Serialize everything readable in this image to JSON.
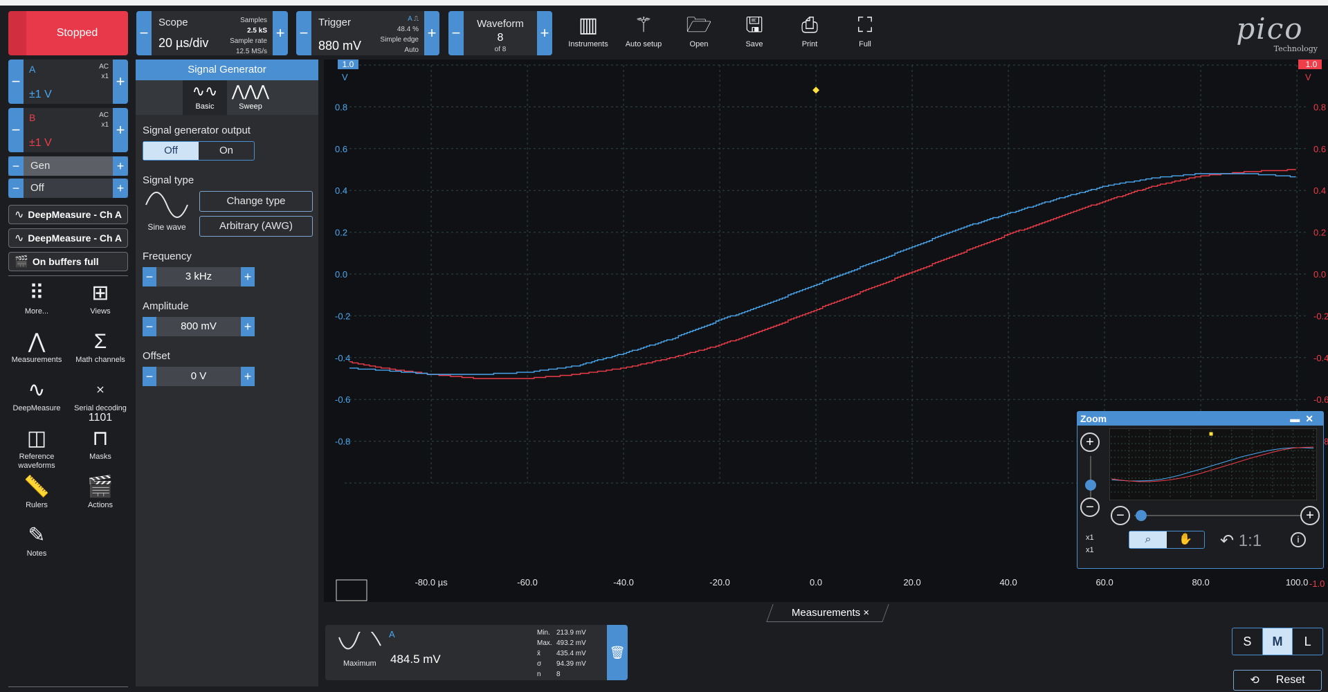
{
  "toolbar": {
    "run_button": "Stopped",
    "scope": {
      "label": "Scope",
      "timebase": "20 µs/div",
      "samples_label": "Samples",
      "samples_value": "2.5 kS",
      "rate_label": "Sample rate",
      "rate_value": "12.5 MS/s"
    },
    "trigger": {
      "label": "Trigger",
      "level": "880 mV",
      "channel": "A",
      "percent": "48.4 %",
      "type": "Simple edge",
      "mode": "Auto"
    },
    "waveform": {
      "label": "Waveform",
      "current": "8",
      "of": "of 8"
    },
    "buttons": [
      {
        "id": "instruments",
        "label": "Instruments",
        "icon": "instruments-icon"
      },
      {
        "id": "auto-setup",
        "label": "Auto setup",
        "icon": "wand-icon"
      },
      {
        "id": "open",
        "label": "Open",
        "icon": "folder-icon"
      },
      {
        "id": "save",
        "label": "Save",
        "icon": "save-icon"
      },
      {
        "id": "print",
        "label": "Print",
        "icon": "print-icon"
      },
      {
        "id": "full",
        "label": "Full",
        "icon": "fullscreen-icon"
      }
    ],
    "logo": {
      "brand": "pico",
      "tagline": "Technology"
    }
  },
  "channels": [
    {
      "name": "A",
      "range": "±1 V",
      "coupling": "AC",
      "probe": "x1",
      "color": "#4aa8f0"
    },
    {
      "name": "B",
      "range": "±1 V",
      "coupling": "AC",
      "probe": "x1",
      "color": "#ef3e4a"
    }
  ],
  "generator_toggle": {
    "label": "Gen",
    "state": "Off"
  },
  "pills": [
    "DeepMeasure - Ch A",
    "DeepMeasure - Ch A",
    "On buffers full"
  ],
  "tools": [
    {
      "label": "More...",
      "icon": "grid-dots-icon"
    },
    {
      "label": "Views",
      "icon": "views-icon"
    },
    {
      "label": "Measurements",
      "icon": "measurements-icon"
    },
    {
      "label": "Math channels",
      "icon": "sigma-icon"
    },
    {
      "label": "DeepMeasure",
      "icon": "deepmeasure-icon"
    },
    {
      "label": "Serial decoding",
      "icon": "serial-decoding-icon"
    },
    {
      "label": "Reference waveforms",
      "icon": "reference-waveforms-icon"
    },
    {
      "label": "Masks",
      "icon": "masks-icon"
    },
    {
      "label": "Rulers",
      "icon": "ruler-icon"
    },
    {
      "label": "Actions",
      "icon": "clapperboard-icon"
    },
    {
      "label": "Notes",
      "icon": "notes-icon"
    }
  ],
  "siggen": {
    "title": "Signal Generator",
    "tabs": [
      "Basic",
      "Sweep"
    ],
    "output_label": "Signal generator output",
    "output_off": "Off",
    "output_on": "On",
    "type_label": "Signal type",
    "wave_name": "Sine wave",
    "change_type": "Change type",
    "arbitrary": "Arbitrary (AWG)",
    "frequency_label": "Frequency",
    "frequency": "3 kHz",
    "amplitude_label": "Amplitude",
    "amplitude": "800 mV",
    "offset_label": "Offset",
    "offset": "0 V"
  },
  "plot": {
    "left_unit": "V",
    "right_unit": "V",
    "top_left_marker": "1.0",
    "top_right_marker": "1.0",
    "y_ticks": [
      "0.8",
      "0.6",
      "0.4",
      "0.2",
      "0.0",
      "-0.2",
      "-0.4",
      "-0.6",
      "-0.8"
    ],
    "y_bottom_right": "-1.0",
    "x_ticks": [
      "-80.0 µs",
      "-60.0",
      "-40.0",
      "-20.0",
      "0.0",
      "20.0",
      "40.0",
      "60.0",
      "80.0",
      "100.0"
    ],
    "x_range_us": [
      -98,
      102
    ],
    "y_range_v": [
      -1.0,
      1.0
    ],
    "trigger_point": {
      "t_us": 0,
      "v": 0.88
    },
    "series_a": {
      "name": "A",
      "color": "#4aa8f0",
      "t_us": [
        -97,
        -90,
        -80,
        -70,
        -60,
        -50,
        -40,
        -30,
        -20,
        -10,
        0,
        10,
        20,
        30,
        40,
        50,
        60,
        70,
        80,
        90,
        100
      ],
      "v": [
        -0.45,
        -0.46,
        -0.48,
        -0.48,
        -0.47,
        -0.44,
        -0.38,
        -0.31,
        -0.22,
        -0.14,
        -0.05,
        0.04,
        0.13,
        0.22,
        0.29,
        0.36,
        0.42,
        0.46,
        0.48,
        0.48,
        0.465
      ]
    },
    "series_b": {
      "name": "B",
      "color": "#ef3e4a",
      "t_us": [
        -97,
        -90,
        -80,
        -70,
        -60,
        -50,
        -40,
        -30,
        -20,
        -10,
        0,
        10,
        20,
        30,
        40,
        50,
        60,
        70,
        80,
        90,
        100
      ],
      "v": [
        -0.42,
        -0.45,
        -0.48,
        -0.5,
        -0.5,
        -0.48,
        -0.45,
        -0.4,
        -0.34,
        -0.26,
        -0.17,
        -0.08,
        0.01,
        0.1,
        0.19,
        0.27,
        0.35,
        0.42,
        0.47,
        0.49,
        0.5
      ]
    }
  },
  "measurements": {
    "tab_label": "Measurements",
    "channel": "A",
    "name": "Maximum",
    "value": "484.5 mV",
    "stats": [
      {
        "k": "Min.",
        "v": "213.9 mV"
      },
      {
        "k": "Max.",
        "v": "493.2 mV"
      },
      {
        "k": "x̄",
        "v": "435.4 mV"
      },
      {
        "k": "σ",
        "v": "94.39 mV"
      },
      {
        "k": "n",
        "v": "8"
      }
    ]
  },
  "zoom": {
    "title": "Zoom",
    "x_factor": "x1",
    "y_factor": "x1",
    "ratio": "1:1"
  },
  "size_buttons": [
    "S",
    "M",
    "L"
  ],
  "selected_size": "M",
  "reset_label": "Reset"
}
